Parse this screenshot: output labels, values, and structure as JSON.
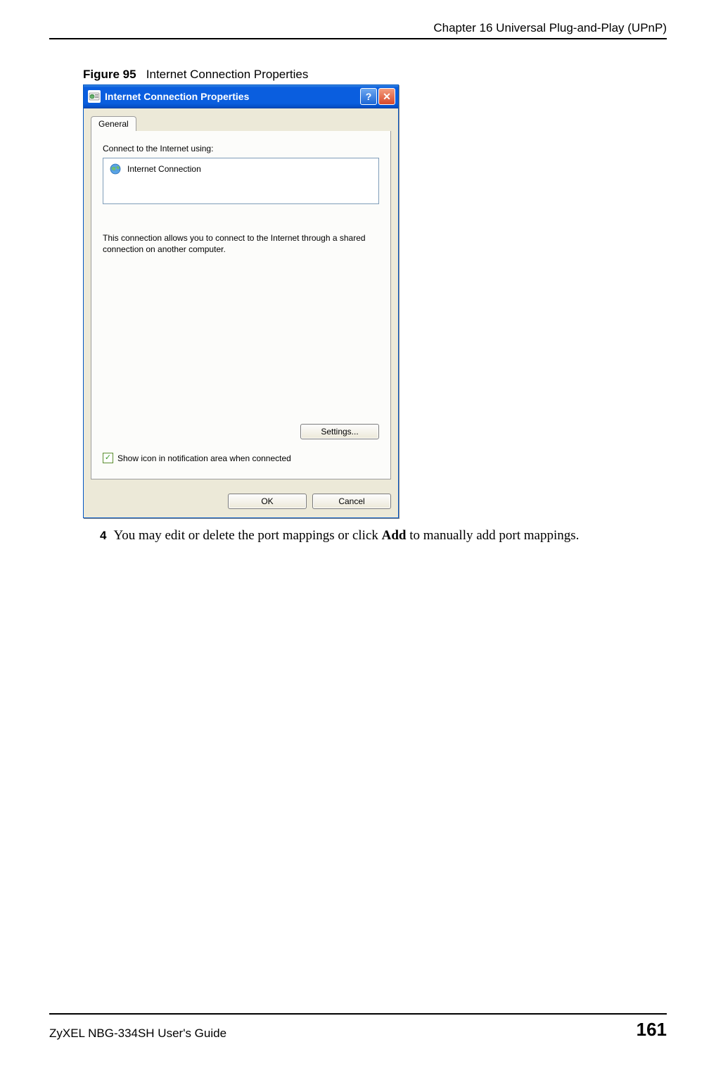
{
  "header": {
    "chapter": "Chapter 16 Universal Plug-and-Play (UPnP)"
  },
  "figure": {
    "label": "Figure 95",
    "title": "Internet Connection Properties"
  },
  "dialog": {
    "title": "Internet Connection Properties",
    "help_symbol": "?",
    "close_symbol": "✕",
    "tab": {
      "general": "General"
    },
    "connect_label": "Connect to the Internet using:",
    "connection_item": "Internet Connection",
    "description": "This connection allows you to connect to the Internet through a shared connection on another computer.",
    "settings_button": "Settings...",
    "checkbox_label": "Show icon in notification area when connected",
    "checkbox_mark": "✓",
    "ok_button": "OK",
    "cancel_button": "Cancel"
  },
  "instruction": {
    "number": "4",
    "text_pre": "You may edit or delete the port mappings or click ",
    "text_bold": "Add",
    "text_post": " to manually add port mappings."
  },
  "footer": {
    "guide": "ZyXEL NBG-334SH User's Guide",
    "page": "161"
  }
}
